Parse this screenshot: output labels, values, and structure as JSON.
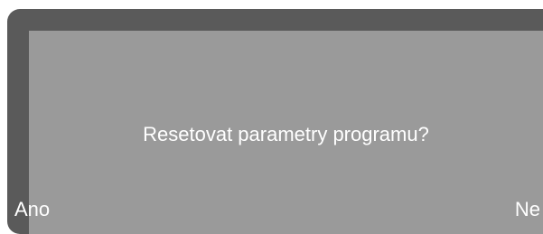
{
  "display": {
    "prompt": "Resetovat parametry programu?",
    "left_softkey": "Ano",
    "right_softkey": "Ne"
  },
  "colors": {
    "bezel": "#5a5a5a",
    "screen_background": "#9a9a9a",
    "text": "#ffffff"
  }
}
